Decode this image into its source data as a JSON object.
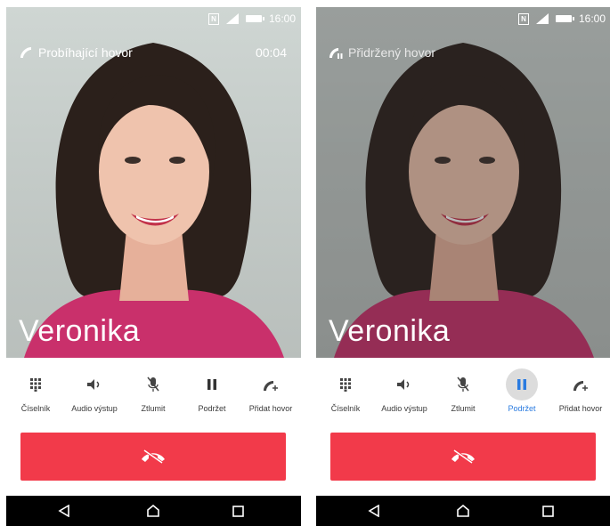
{
  "status_bar": {
    "time": "16:00"
  },
  "screens": [
    {
      "call_status": "Probíhající hovor",
      "timer": "00:04",
      "caller_name": "Veronika",
      "controls": [
        {
          "label": "Číselník",
          "icon": "dialpad-icon"
        },
        {
          "label": "Audio výstup",
          "icon": "speaker-icon"
        },
        {
          "label": "Ztlumit",
          "icon": "mute-mic-icon"
        },
        {
          "label": "Podržet",
          "icon": "pause-icon"
        },
        {
          "label": "Přidat hovor",
          "icon": "add-call-icon"
        }
      ]
    },
    {
      "call_status": "Přidržený hovor",
      "caller_name": "Veronika",
      "active_control": "Podržet",
      "controls": [
        {
          "label": "Číselník",
          "icon": "dialpad-icon"
        },
        {
          "label": "Audio výstup",
          "icon": "speaker-icon"
        },
        {
          "label": "Ztlumit",
          "icon": "mute-mic-icon"
        },
        {
          "label": "Podržet",
          "icon": "pause-icon"
        },
        {
          "label": "Přidat hovor",
          "icon": "add-call-icon"
        }
      ]
    }
  ],
  "colors": {
    "end_call": "#f23a4a",
    "active": "#2a7be0",
    "nav": "#000000"
  }
}
